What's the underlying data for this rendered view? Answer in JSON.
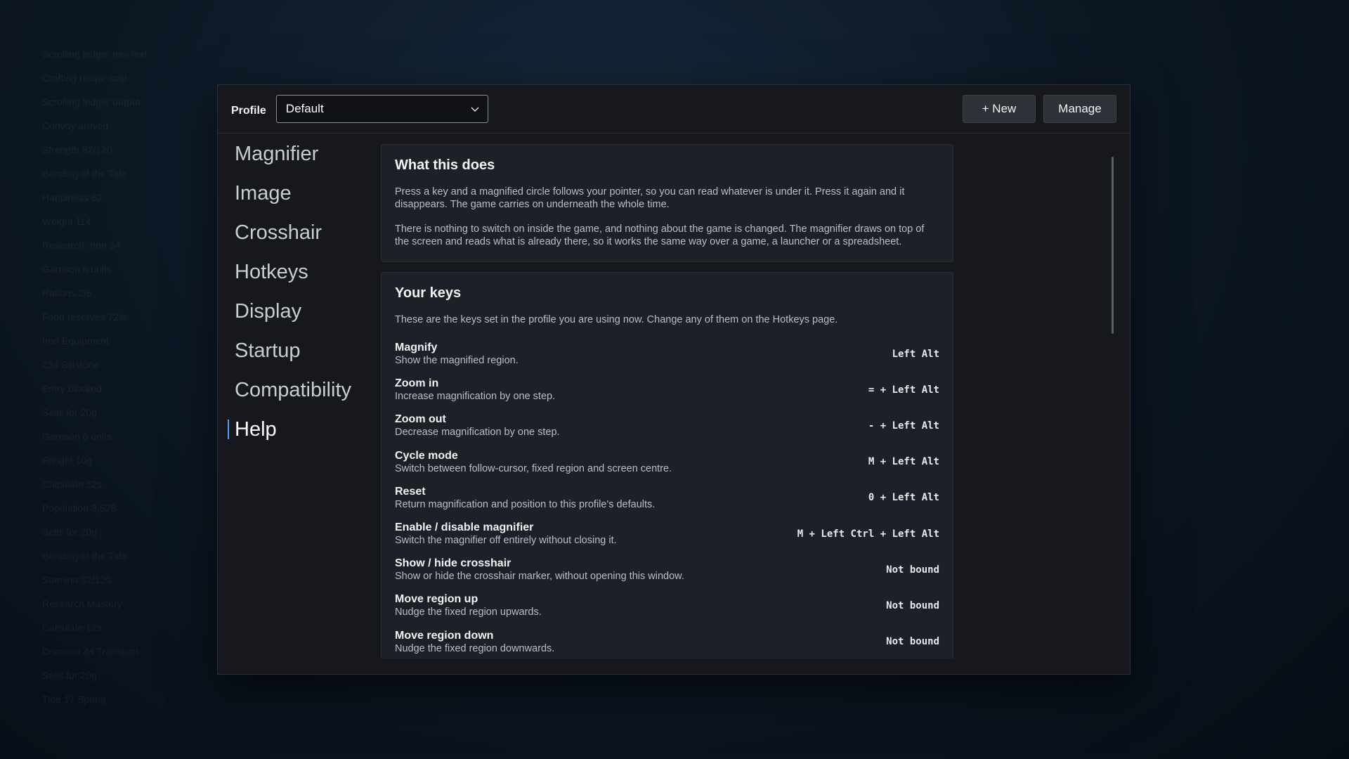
{
  "background_list": [
    "Scrolling ledger row text",
    "Crafting recipe cost",
    "Scrolling ledger output",
    "Convoy arrived",
    "Strength 82/120",
    "Bending of the Tide",
    "Happiness 62",
    "Weight 114",
    "Research: Iron 34",
    "Garrison 6 units",
    "Rations 2/6",
    "Food reserves 72%",
    "Iron Equipment",
    "234 Siltstone",
    "Entry blocked",
    "Sells for 20g",
    "Garrison 6 units",
    "Freight 10g",
    "Calculate 12s",
    "Population 3,526",
    "Sells for 20g",
    "Bending of the Tide",
    "Stamina 82/120",
    "Research Mastery",
    "Calculate 12s",
    "Distance 44 Transport",
    "Sells for 20g",
    "Tide 17 Spring"
  ],
  "topbar": {
    "profile_label": "Profile",
    "profile_value": "Default",
    "new_label": "+ New",
    "manage_label": "Manage"
  },
  "sidebar": {
    "items": [
      {
        "label": "Magnifier"
      },
      {
        "label": "Image"
      },
      {
        "label": "Crosshair"
      },
      {
        "label": "Hotkeys"
      },
      {
        "label": "Display"
      },
      {
        "label": "Startup"
      },
      {
        "label": "Compatibility"
      },
      {
        "label": "Help",
        "active": true
      }
    ]
  },
  "what_this_does": {
    "title": "What this does",
    "p1": "Press a key and a magnified circle follows your pointer, so you can read whatever is under it. Press it again and it disappears. The game carries on underneath the whole time.",
    "p2": "There is nothing to switch on inside the game, and nothing about the game is changed. The magnifier draws on top of the screen and reads what is already there, so it works the same way over a game, a launcher or a spreadsheet."
  },
  "your_keys": {
    "title": "Your keys",
    "intro": "These are the keys set in the profile you are using now. Change any of them on the Hotkeys page.",
    "keys": [
      {
        "title": "Magnify",
        "desc": "Show the magnified region.",
        "bind": "Left Alt"
      },
      {
        "title": "Zoom in",
        "desc": "Increase magnification by one step.",
        "bind": "= + Left Alt"
      },
      {
        "title": "Zoom out",
        "desc": "Decrease magnification by one step.",
        "bind": "- + Left Alt"
      },
      {
        "title": "Cycle mode",
        "desc": "Switch between follow-cursor, fixed region and screen centre.",
        "bind": "M + Left Alt"
      },
      {
        "title": "Reset",
        "desc": "Return magnification and position to this profile's defaults.",
        "bind": "0 + Left Alt"
      },
      {
        "title": "Enable / disable magnifier",
        "desc": "Switch the magnifier off entirely without closing it.",
        "bind": "M + Left Ctrl + Left Alt"
      },
      {
        "title": "Show / hide crosshair",
        "desc": "Show or hide the crosshair marker, without opening this window.",
        "bind": "Not bound"
      },
      {
        "title": "Move region up",
        "desc": "Nudge the fixed region upwards.",
        "bind": "Not bound"
      },
      {
        "title": "Move region down",
        "desc": "Nudge the fixed region downwards.",
        "bind": "Not bound"
      }
    ]
  }
}
